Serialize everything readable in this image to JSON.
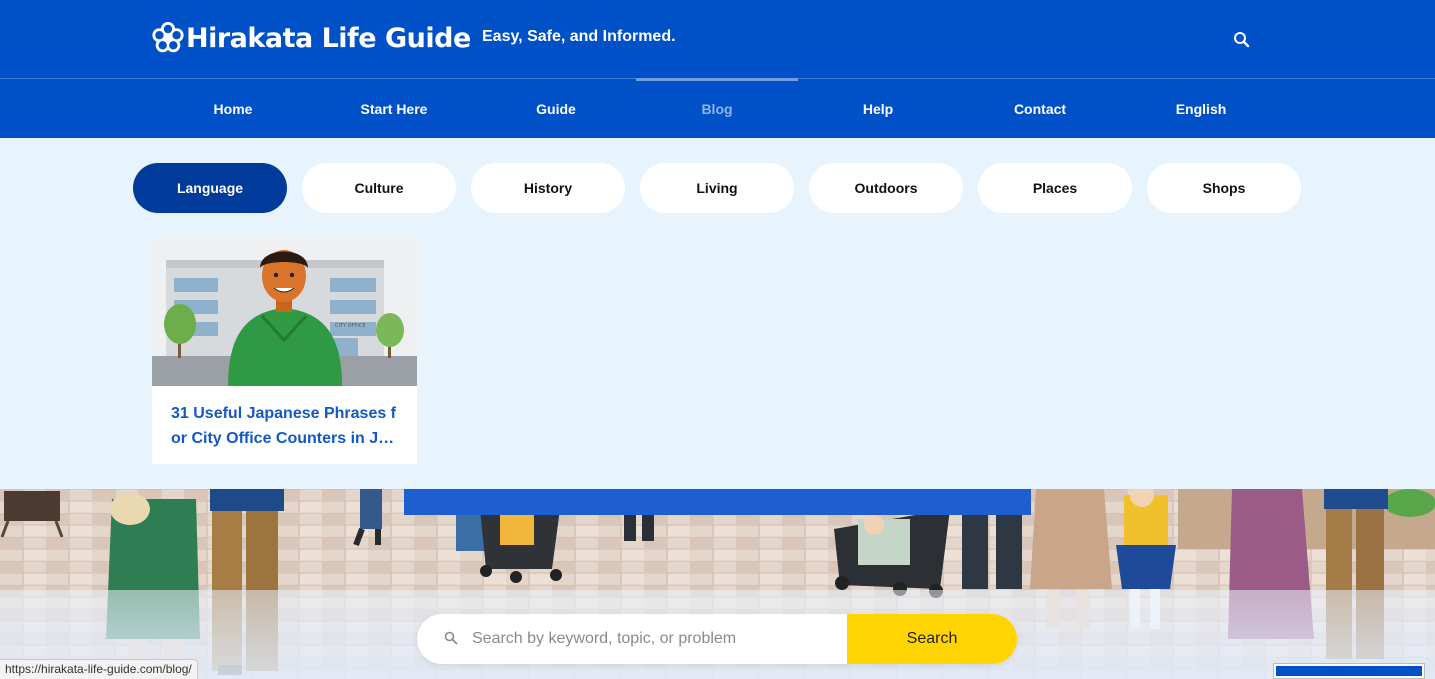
{
  "header": {
    "logo_text": "Hirakata Life Guide",
    "tagline": "Easy, Safe, and Informed."
  },
  "nav": {
    "items": [
      {
        "label": "Home"
      },
      {
        "label": "Start Here"
      },
      {
        "label": "Guide"
      },
      {
        "label": "Blog",
        "active": true
      },
      {
        "label": "Help"
      },
      {
        "label": "Contact"
      },
      {
        "label": "English"
      }
    ]
  },
  "categories": {
    "items": [
      {
        "label": "Language",
        "active": true
      },
      {
        "label": "Culture"
      },
      {
        "label": "History"
      },
      {
        "label": "Living"
      },
      {
        "label": "Outdoors"
      },
      {
        "label": "Places"
      },
      {
        "label": "Shops"
      }
    ]
  },
  "posts": [
    {
      "title_line1": "31 Useful Japanese Phrases f",
      "title_line2": "or City Office Counters in J…",
      "image_sign": "CITY OFFICE"
    }
  ],
  "search": {
    "placeholder": "Search by keyword, topic, or problem",
    "button_label": "Search"
  },
  "status_bar": {
    "url": "https://hirakata-life-guide.com/blog/"
  },
  "colors": {
    "brand_blue": "#0050c8",
    "active_pill": "#003a9a",
    "page_bg": "#e8f4fd",
    "search_button": "#ffd400",
    "post_title": "#1358c4"
  }
}
